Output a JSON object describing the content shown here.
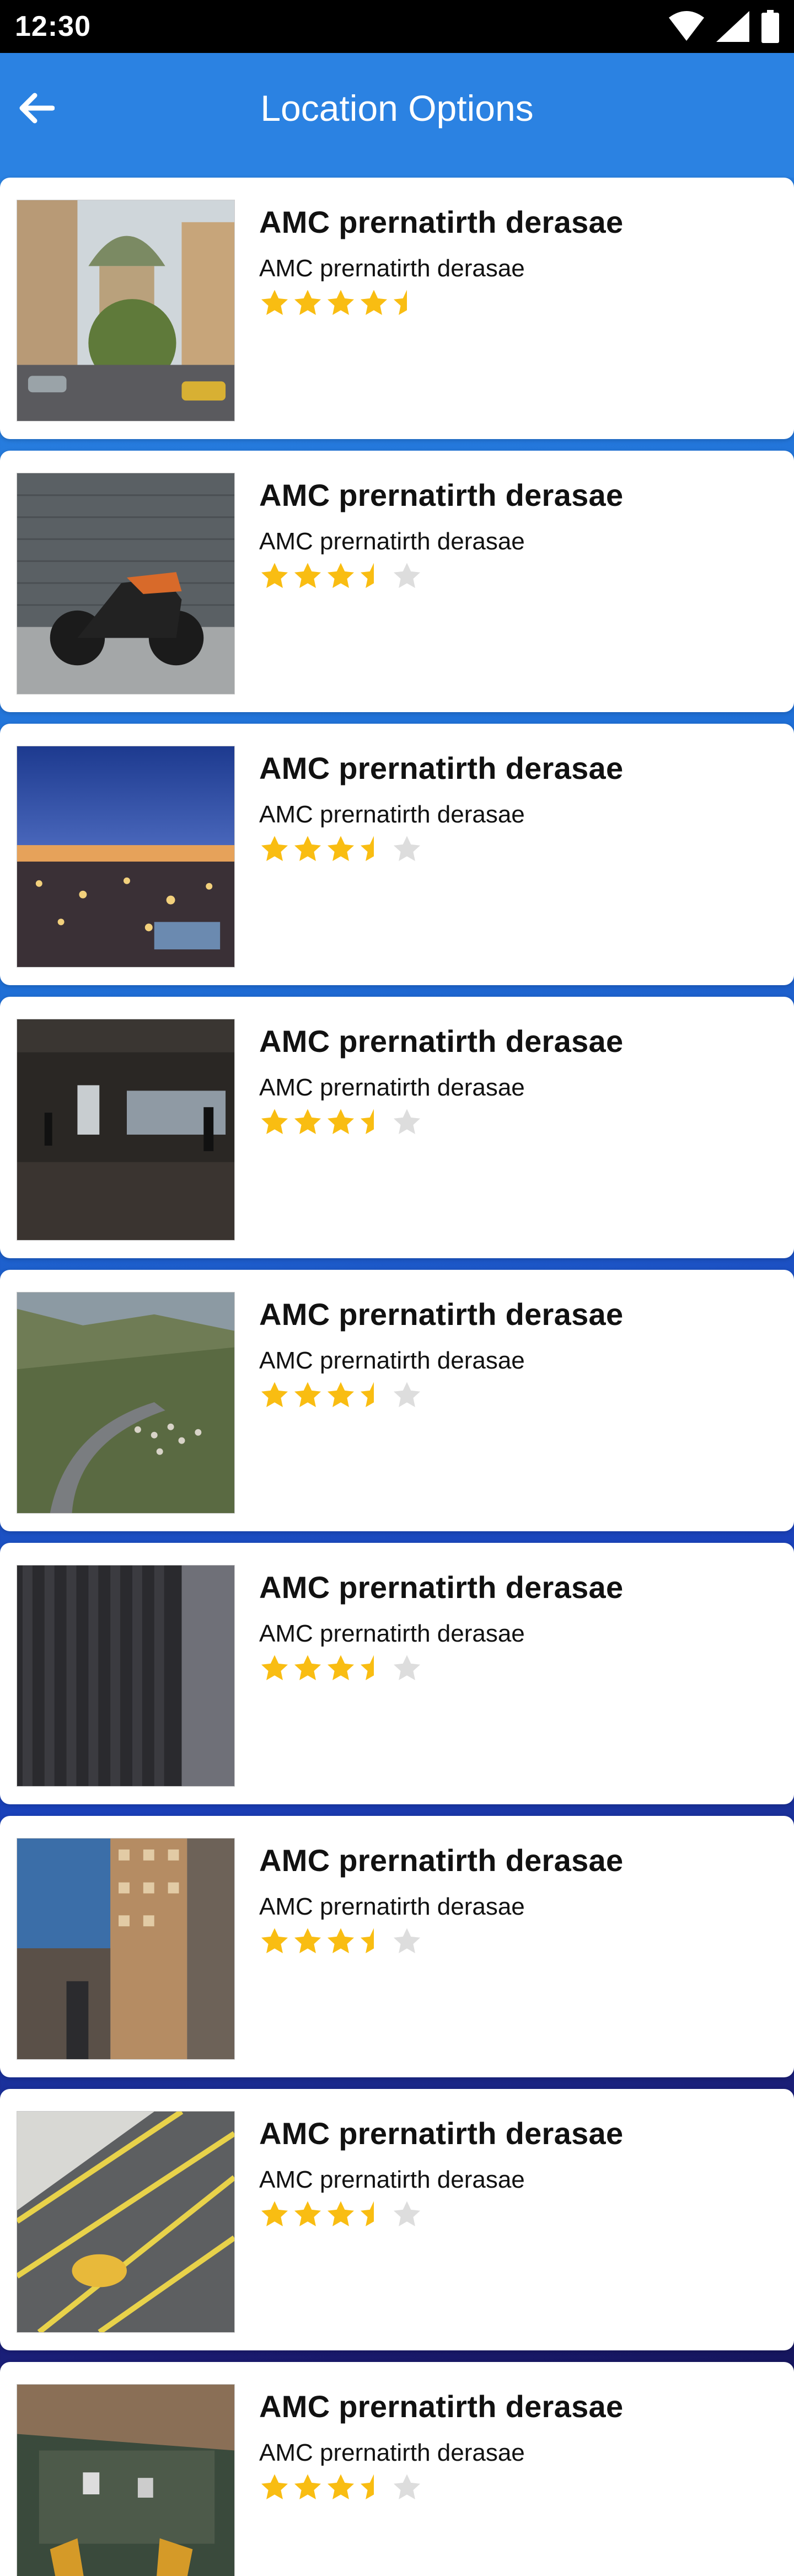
{
  "status_bar": {
    "time": "12:30",
    "icons": [
      "wifi-icon",
      "signal-icon",
      "battery-icon"
    ]
  },
  "app_bar": {
    "title": "Location Options",
    "back_icon": "arrow-left-icon",
    "color": "#2b82e2"
  },
  "colors": {
    "star": "#f9bd12",
    "star_empty": "#dddddd",
    "card_bg": "#ffffff"
  },
  "locations": [
    {
      "title": "AMC prernatirth derasae",
      "subtitle": "AMC prernatirth derasae",
      "rating": 4.5,
      "image": "city-street-dome"
    },
    {
      "title": "AMC prernatirth derasae",
      "subtitle": "AMC prernatirth derasae",
      "rating": 3.5,
      "image": "motorcycle-wall"
    },
    {
      "title": "AMC prernatirth derasae",
      "subtitle": "AMC prernatirth derasae",
      "rating": 3.5,
      "image": "night-market"
    },
    {
      "title": "AMC prernatirth derasae",
      "subtitle": "AMC prernatirth derasae",
      "rating": 3.5,
      "image": "parking-garage-people"
    },
    {
      "title": "AMC prernatirth derasae",
      "subtitle": "AMC prernatirth derasae",
      "rating": 3.5,
      "image": "mountain-road-sheep"
    },
    {
      "title": "AMC prernatirth derasae",
      "subtitle": "AMC prernatirth derasae",
      "rating": 3.5,
      "image": "dark-ribbed-wall"
    },
    {
      "title": "AMC prernatirth derasae",
      "subtitle": "AMC prernatirth derasae",
      "rating": 3.5,
      "image": "tall-buildings-aerial"
    },
    {
      "title": "AMC prernatirth derasae",
      "subtitle": "AMC prernatirth derasae",
      "rating": 3.5,
      "image": "parking-lot-yellow-car"
    },
    {
      "title": "AMC prernatirth derasae",
      "subtitle": "AMC prernatirth derasae",
      "rating": 3.5,
      "image": "feet-over-city"
    }
  ]
}
